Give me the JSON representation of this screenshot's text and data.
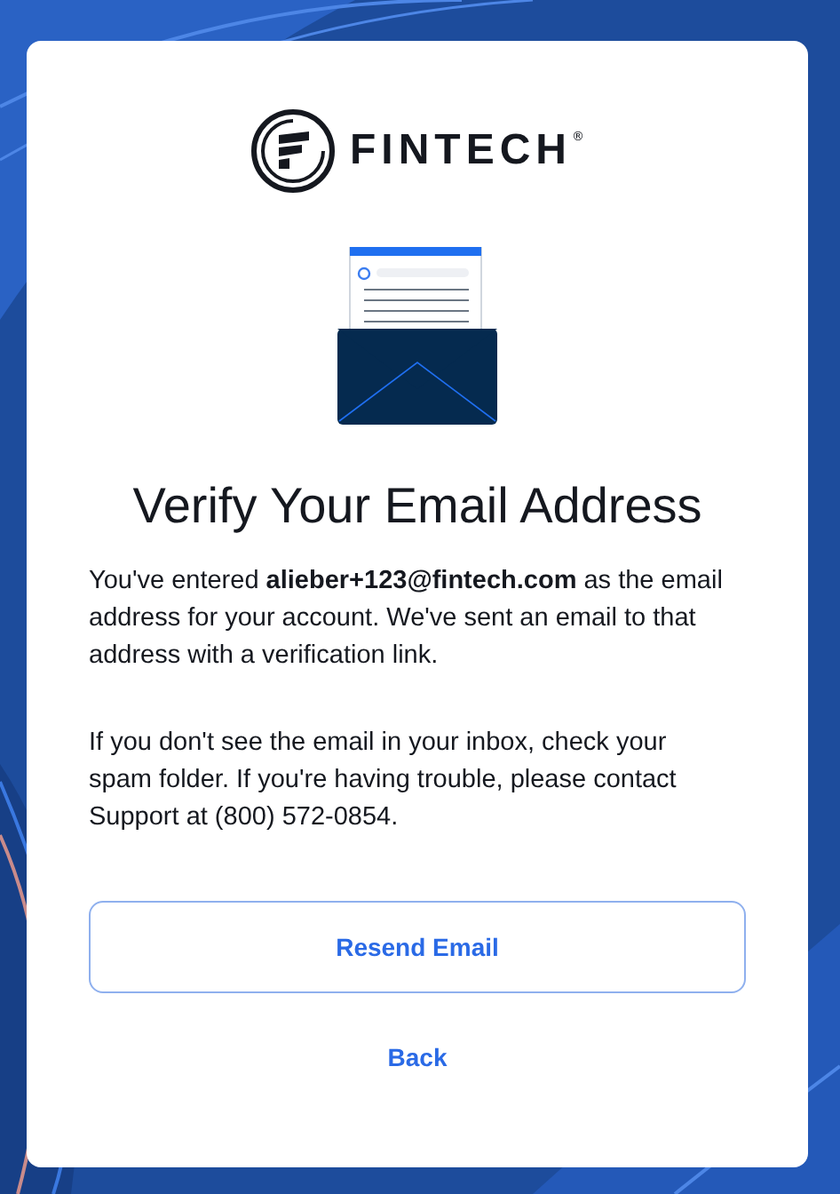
{
  "logo": {
    "wordmark": "FINTECH",
    "mark": "®"
  },
  "heading": "Verify Your Email Address",
  "paragraphs": [
    "You've entered **alieber+123@fintech.com** as the email address for your account. We've sent an email to that address with a verification link.",
    "If you don't see the email in your inbox, check your spam folder. If you're having trouble, please contact Support at (800) 572-0854."
  ],
  "resend_button": {
    "label": "Resend Email"
  },
  "back_link": {
    "label": "Back"
  }
}
